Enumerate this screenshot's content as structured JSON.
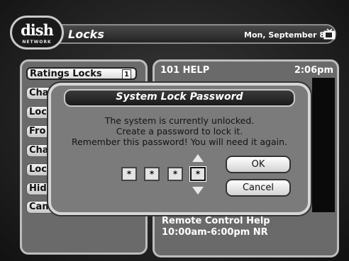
{
  "brand": {
    "logo_text": "dish",
    "logo_sub": "NETWORK"
  },
  "header": {
    "title": "Locks",
    "date": "Mon, September 8"
  },
  "menu": {
    "items": [
      {
        "label": "Ratings Locks",
        "number": "1"
      },
      {
        "label": "Cha"
      },
      {
        "label": "Loc"
      },
      {
        "label": "Fro"
      },
      {
        "label": "Cha"
      },
      {
        "label": "Loc"
      },
      {
        "label": "Hid"
      },
      {
        "label": "Can"
      }
    ]
  },
  "channel_info": {
    "channel": "101 HELP",
    "time": "2:06pm",
    "program_title": "Remote Control Help",
    "program_time": "10:00am-6:00pm NR"
  },
  "dialog": {
    "title": "System Lock Password",
    "message_line1": "The system is currently unlocked.",
    "message_line2": "Create a password to lock it.",
    "message_line3": "Remember this password! You will need it again.",
    "password_digits": [
      "*",
      "*",
      "*",
      "*"
    ],
    "ok_label": "OK",
    "cancel_label": "Cancel"
  }
}
